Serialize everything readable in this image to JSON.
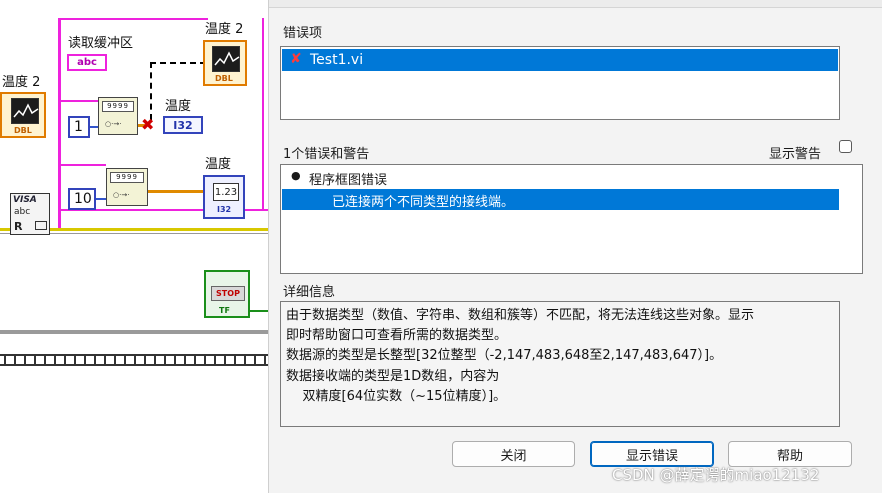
{
  "diagram": {
    "labels": {
      "temp_top_right": "温度 2",
      "read_buffer": "读取缓冲区",
      "temp_left": "温度 2",
      "temp_i32": "温度",
      "temp_dbl": "温度"
    },
    "indicators": {
      "dbl_tag": "DBL",
      "i32_tag": "I32",
      "abc_tag": "abc",
      "num_value": "1.23"
    },
    "constants": {
      "one": "1",
      "ten": "10"
    },
    "visa": {
      "title": "VISA",
      "abc": "abc",
      "r": "R"
    },
    "stop": {
      "label": "STOP",
      "tf": "TF"
    },
    "subvi_text": "9999"
  },
  "dialog": {
    "errors_label": "错误项",
    "error_items": [
      {
        "name": "Test1.vi",
        "selected": true
      }
    ],
    "count_label": "1个错误和警告",
    "show_warnings_label": "显示警告",
    "show_warnings_checked": false,
    "tree": {
      "group": "程序框图错误",
      "item": "已连接两个不同类型的接线端。"
    },
    "details_label": "详细信息",
    "details_lines": [
      "由于数据类型（数值、字符串、数组和簇等）不匹配，将无法连线这些对象。显示",
      "即时帮助窗口可查看所需的数据类型。",
      "数据源的类型是长整型[32位整型（-2,147,483,648至2,147,483,647）]。",
      "数据接收端的类型是1D数组，内容为",
      "    双精度[64位实数（~15位精度）]。"
    ],
    "buttons": {
      "close": "关闭",
      "show_error": "显示错误",
      "help": "帮助"
    }
  },
  "watermark": "CSDN @薛定谔的miao12132",
  "colors": {
    "selection": "#0078d7",
    "wire_pink": "#ee22dd",
    "wire_blue": "#3355cc",
    "error_x": "#d00000"
  }
}
